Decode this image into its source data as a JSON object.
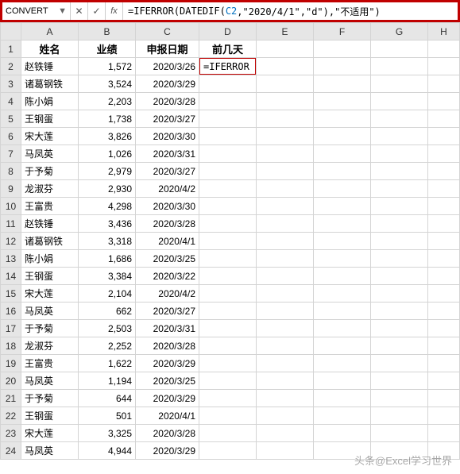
{
  "namebox": {
    "value": "CONVERT"
  },
  "formula_bar": {
    "cancel": "✕",
    "confirm": "✓",
    "fx": "fx",
    "prefix": "=IFERROR(DATEDIF(",
    "ref": "C2",
    "suffix": ",\"2020/4/1\",\"d\"),\"不适用\")"
  },
  "columns": [
    "A",
    "B",
    "C",
    "D",
    "E",
    "F",
    "G",
    "H"
  ],
  "headers": {
    "A": "姓名",
    "B": "业绩",
    "C": "申报日期",
    "D": "前几天"
  },
  "active_cell": {
    "display": "=IFERROR"
  },
  "rows": [
    {
      "n": 2,
      "name": "赵铁锤",
      "perf": "1,572",
      "date": "2020/3/26"
    },
    {
      "n": 3,
      "name": "诸葛钢铁",
      "perf": "3,524",
      "date": "2020/3/29"
    },
    {
      "n": 4,
      "name": "陈小娟",
      "perf": "2,203",
      "date": "2020/3/28"
    },
    {
      "n": 5,
      "name": "王钢蛋",
      "perf": "1,738",
      "date": "2020/3/27"
    },
    {
      "n": 6,
      "name": "宋大莲",
      "perf": "3,826",
      "date": "2020/3/30"
    },
    {
      "n": 7,
      "name": "马凤英",
      "perf": "1,026",
      "date": "2020/3/31"
    },
    {
      "n": 8,
      "name": "于予菊",
      "perf": "2,979",
      "date": "2020/3/27"
    },
    {
      "n": 9,
      "name": "龙淑芬",
      "perf": "2,930",
      "date": "2020/4/2"
    },
    {
      "n": 10,
      "name": "王富贵",
      "perf": "4,298",
      "date": "2020/3/30"
    },
    {
      "n": 11,
      "name": "赵铁锤",
      "perf": "3,436",
      "date": "2020/3/28"
    },
    {
      "n": 12,
      "name": "诸葛钢铁",
      "perf": "3,318",
      "date": "2020/4/1"
    },
    {
      "n": 13,
      "name": "陈小娟",
      "perf": "1,686",
      "date": "2020/3/25"
    },
    {
      "n": 14,
      "name": "王钢蛋",
      "perf": "3,384",
      "date": "2020/3/22"
    },
    {
      "n": 15,
      "name": "宋大莲",
      "perf": "2,104",
      "date": "2020/4/2"
    },
    {
      "n": 16,
      "name": "马凤英",
      "perf": "662",
      "date": "2020/3/27"
    },
    {
      "n": 17,
      "name": "于予菊",
      "perf": "2,503",
      "date": "2020/3/31"
    },
    {
      "n": 18,
      "name": "龙淑芬",
      "perf": "2,252",
      "date": "2020/3/28"
    },
    {
      "n": 19,
      "name": "王富贵",
      "perf": "1,622",
      "date": "2020/3/29"
    },
    {
      "n": 20,
      "name": "马凤英",
      "perf": "1,194",
      "date": "2020/3/25"
    },
    {
      "n": 21,
      "name": "于予菊",
      "perf": "644",
      "date": "2020/3/29"
    },
    {
      "n": 22,
      "name": "王钢蛋",
      "perf": "501",
      "date": "2020/4/1"
    },
    {
      "n": 23,
      "name": "宋大莲",
      "perf": "3,325",
      "date": "2020/3/28"
    },
    {
      "n": 24,
      "name": "马凤英",
      "perf": "4,944",
      "date": "2020/3/29"
    }
  ],
  "watermark": "头条@Excel学习世界"
}
